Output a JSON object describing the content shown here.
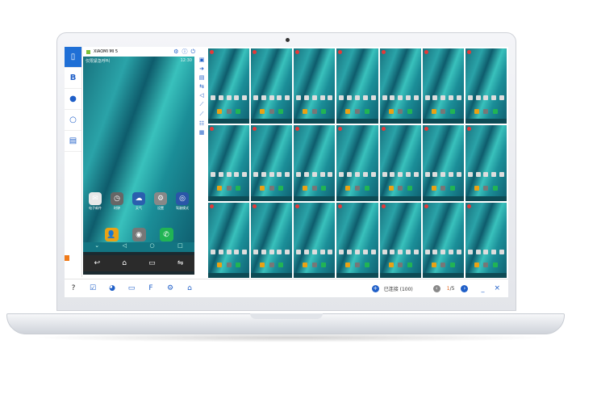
{
  "device": {
    "name": "XIAOMI MI 5",
    "header_icons": [
      "settings-icon",
      "info-icon",
      "power-icon"
    ]
  },
  "phone": {
    "status_left": "仅限紧急呼叫",
    "status_right": "12:30",
    "apps": [
      {
        "label": "电子邮件",
        "icon": "✉",
        "color": "#e8e8e8"
      },
      {
        "label": "时钟",
        "icon": "◷",
        "color": "#666"
      },
      {
        "label": "天气",
        "icon": "☁",
        "color": "#2a5fae"
      },
      {
        "label": "设置",
        "icon": "⚙",
        "color": "#888"
      },
      {
        "label": "驾驶模式",
        "icon": "◎",
        "color": "#2a56a8"
      }
    ],
    "dock": [
      {
        "icon": "👤",
        "color": "#e9a215"
      },
      {
        "icon": "◉",
        "color": "#777"
      },
      {
        "icon": "✆",
        "color": "#21b454"
      }
    ]
  },
  "sidebar": [
    "phone",
    "file",
    "chat",
    "sync",
    "apps"
  ],
  "toolbar_right": [
    "▣",
    "➜",
    "▤",
    "⇆",
    "◁",
    "⟋",
    "⟋",
    "☷",
    "▦"
  ],
  "grid": {
    "count": 21
  },
  "bottom": {
    "connected_label": "已连接 (100)",
    "page": "1",
    "page_total": "/5",
    "minimize": "_",
    "close": "×"
  },
  "bottom_tools": [
    "?",
    "☑",
    "◕",
    "▭",
    "F",
    "⚙",
    "⌂"
  ]
}
